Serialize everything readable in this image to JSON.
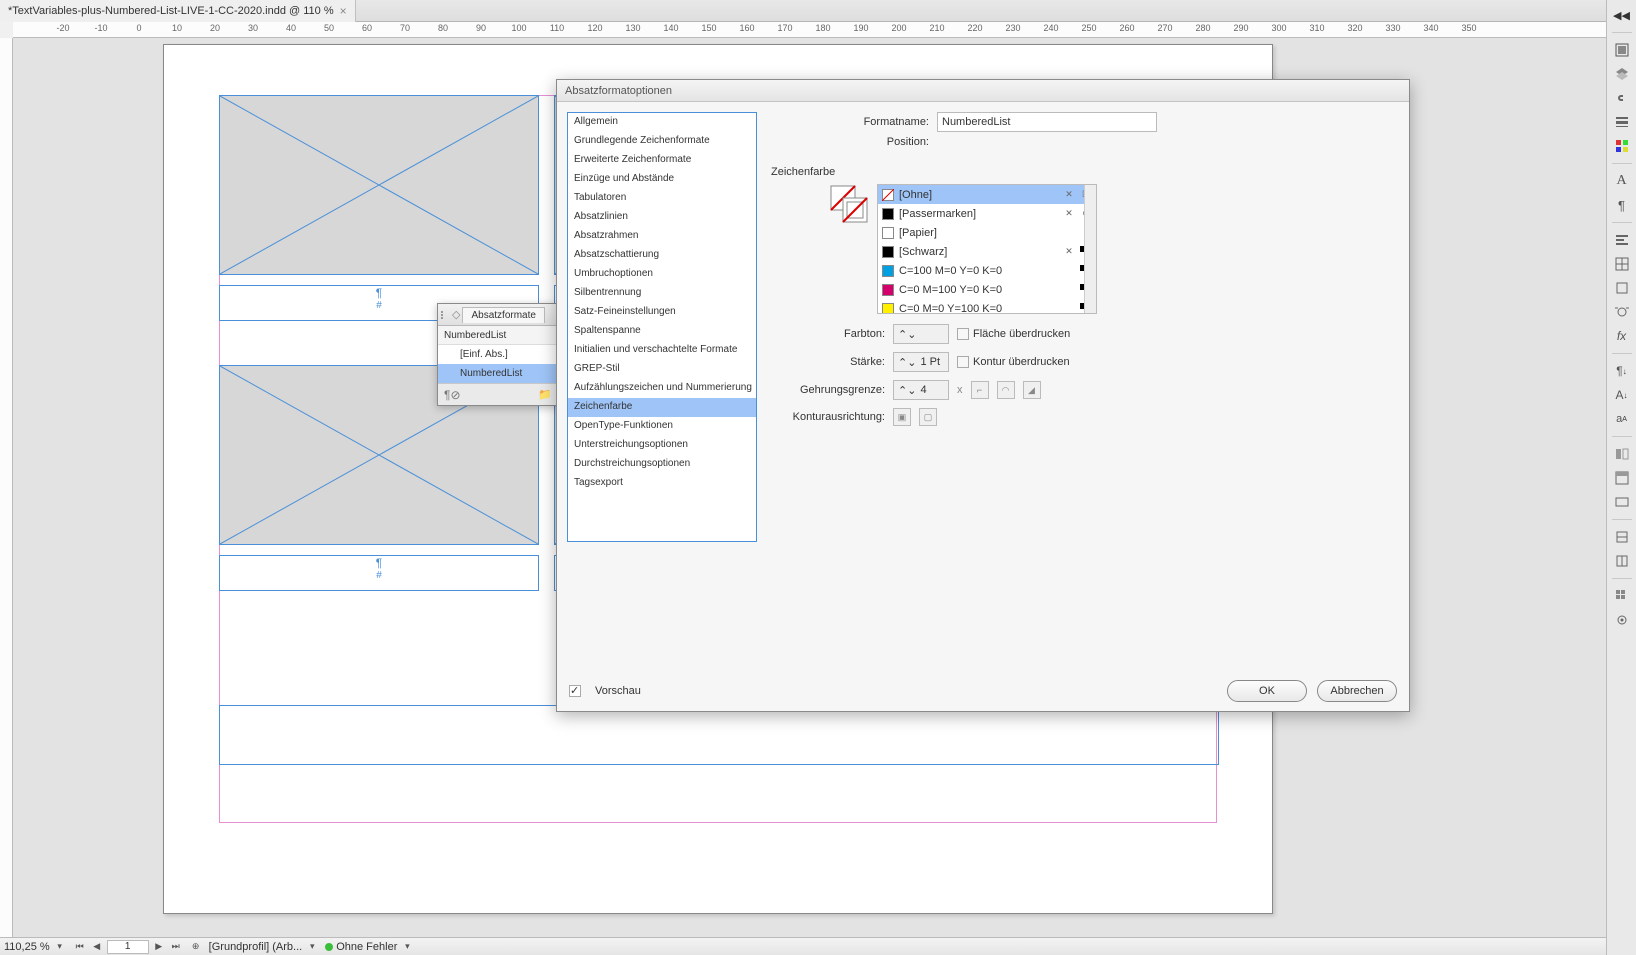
{
  "tab": {
    "title": "*TextVariables-plus-Numbered-List-LIVE-1-CC-2020.indd @ 110 %"
  },
  "ruler_marks": [
    -20,
    -10,
    0,
    10,
    20,
    30,
    40,
    50,
    60,
    70,
    80,
    90,
    100,
    110,
    120,
    130,
    140,
    150,
    160,
    170,
    180,
    190,
    200,
    210,
    220,
    230,
    240,
    250,
    260,
    270,
    280,
    290,
    300,
    310,
    320,
    330,
    340,
    350
  ],
  "panel": {
    "tab": "Absatzformate",
    "head": "NumberedList",
    "items": [
      {
        "label": "[Einf. Abs.]",
        "selected": false,
        "indent": true
      },
      {
        "label": "NumberedList",
        "selected": true,
        "indent": true
      }
    ]
  },
  "dialog": {
    "title": "Absatzformatoptionen",
    "formatname_label": "Formatname:",
    "formatname_value": "NumberedList",
    "position_label": "Position:",
    "section": "Zeichenfarbe",
    "categories": [
      "Allgemein",
      "Grundlegende Zeichenformate",
      "Erweiterte Zeichenformate",
      "Einzüge und Abstände",
      "Tabulatoren",
      "Absatzlinien",
      "Absatzrahmen",
      "Absatzschattierung",
      "Umbruchoptionen",
      "Silbentrennung",
      "Satz-Feineinstellungen",
      "Spaltenspanne",
      "Initialien und verschachtelte Formate",
      "GREP-Stil",
      "Aufzählungszeichen und Nummerierung",
      "Zeichenfarbe",
      "OpenType-Funktionen",
      "Unterstreichungsoptionen",
      "Durchstreichungsoptionen",
      "Tagsexport"
    ],
    "cat_selected": "Zeichenfarbe",
    "swatches": [
      {
        "name": "[Ohne]",
        "chip": "none",
        "lock": true,
        "box": true,
        "selected": true
      },
      {
        "name": "[Passermarken]",
        "chip": "#000",
        "lock": true,
        "reg": true
      },
      {
        "name": "[Papier]",
        "chip": "#fff"
      },
      {
        "name": "[Schwarz]",
        "chip": "#000",
        "lock": true,
        "cmyk": true
      },
      {
        "name": "C=100 M=0 Y=0 K=0",
        "chip": "#00a0e3",
        "cmyk": true
      },
      {
        "name": "C=0 M=100 Y=0 K=0",
        "chip": "#d6006d",
        "cmyk": true
      },
      {
        "name": "C=0 M=0 Y=100 K=0",
        "chip": "#fff000",
        "cmyk": true
      }
    ],
    "labels": {
      "farbton": "Farbton:",
      "staerke": "Stärke:",
      "staerke_val": "1 Pt",
      "gehrung": "Gehrungsgrenze:",
      "gehrung_val": "4",
      "gehrung_x": "x",
      "kontur": "Konturausrichtung:",
      "flaeche_chk": "Fläche überdrucken",
      "kontur_chk": "Kontur überdrucken"
    },
    "preview": "Vorschau",
    "ok": "OK",
    "cancel": "Abbrechen"
  },
  "status": {
    "zoom": "110,25 %",
    "page": "1",
    "profile": "[Grundprofil] (Arb...",
    "errors": "Ohne Fehler"
  }
}
